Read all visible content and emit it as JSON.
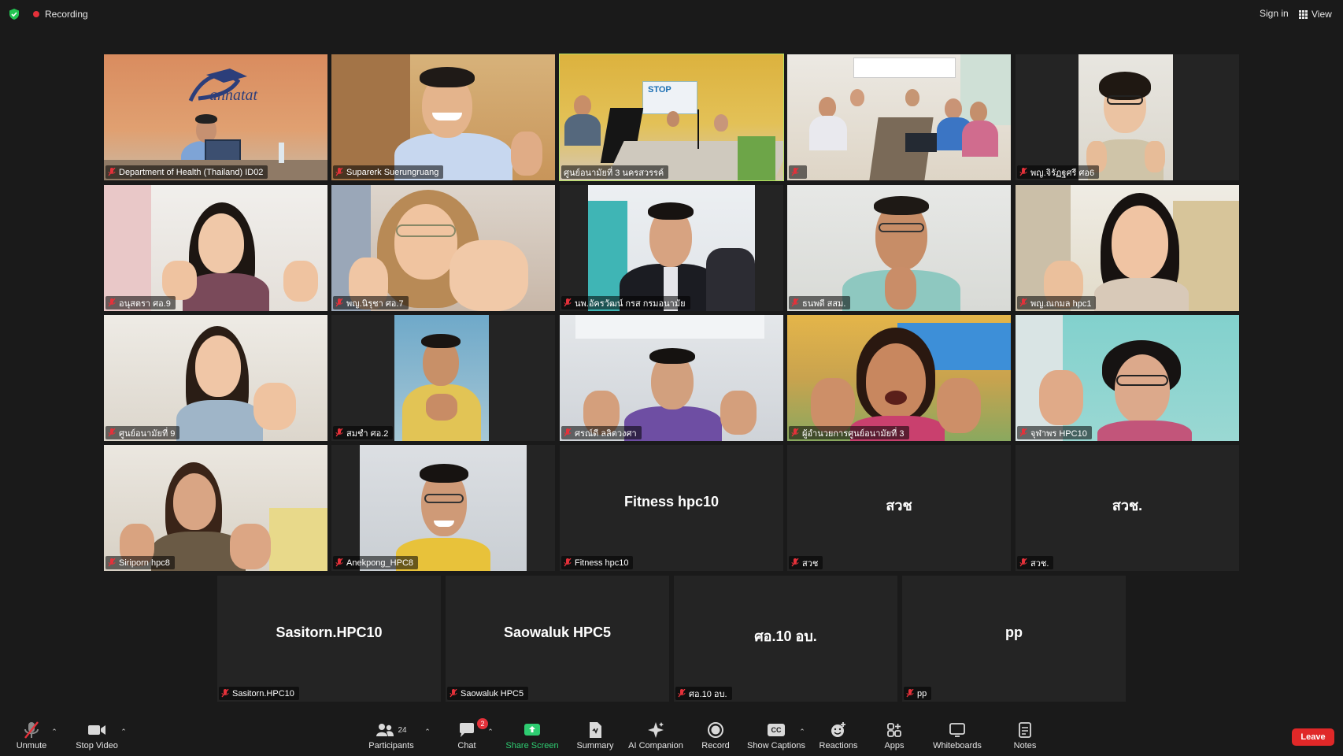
{
  "top_bar": {
    "recording_label": "Recording",
    "sign_in_label": "Sign in",
    "view_label": "View"
  },
  "tiles": [
    {
      "name": "Department of Health (Thailand) ID02"
    },
    {
      "name": "Suparerk Suerungruang"
    },
    {
      "name": "ศูนย์อนามัยที่ 3 นครสวรรค์"
    },
    {
      "name": ""
    },
    {
      "name": "พญ.จิรัฏฐศรี ศอ6"
    },
    {
      "name": "อนุสตรา ศอ.9"
    },
    {
      "name": "พญ.นิรุชา ศอ.7"
    },
    {
      "name": "นพ.อัครวัฒน์ กรส กรมอนามัย"
    },
    {
      "name": "ธนพดี สสม."
    },
    {
      "name": "พญ.ณกมล hpc1"
    },
    {
      "name": "ศูนย์อนามัยที่ 9"
    },
    {
      "name": "สมชำ ศอ.2"
    },
    {
      "name": "ศรณ์ดี ลลิตวงศา"
    },
    {
      "name": "ผู้อำนวยการศูนย์อนามัยที่ 3"
    },
    {
      "name": "จุฬาพร HPC10"
    },
    {
      "name": "Siriporn hpc8"
    },
    {
      "name": "Anekpong_HPC8"
    },
    {
      "name": "Fitness hpc10",
      "big": "Fitness hpc10"
    },
    {
      "name": "สวช",
      "big": "สวช"
    },
    {
      "name": "สวช.",
      "big": "สวช."
    },
    {
      "name": "Sasitorn.HPC10",
      "big": "Sasitorn.HPC10"
    },
    {
      "name": "Saowaluk HPC5",
      "big": "Saowaluk HPC5"
    },
    {
      "name": "ศอ.10 อบ.",
      "big": "ศอ.10 อบ."
    },
    {
      "name": "pp",
      "big": "pp"
    }
  ],
  "tile_3_banner": "STOP",
  "toolbar": {
    "unmute": "Unmute",
    "stop_video": "Stop Video",
    "participants": "Participants",
    "participants_count": "24",
    "chat": "Chat",
    "chat_badge": "2",
    "share_screen": "Share Screen",
    "summary": "Summary",
    "ai_companion": "AI Companion",
    "record": "Record",
    "show_captions": "Show Captions",
    "captions_icon_text": "CC",
    "reactions": "Reactions",
    "apps": "Apps",
    "whiteboards": "Whiteboards",
    "notes": "Notes",
    "leave": "Leave"
  },
  "colors": {
    "background": "#1a1a1a",
    "tile_background": "#242424",
    "active_speaker_border": "#b5e061",
    "recording_dot": "#e5313a",
    "share_screen_green": "#2ecc71",
    "leave_red": "#e02828",
    "muted_mic_red": "#e5313a"
  }
}
